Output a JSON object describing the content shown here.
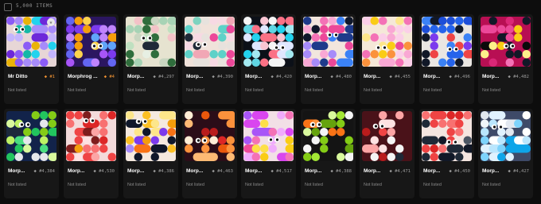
{
  "header": {
    "item_count": "5,000 ITEMS"
  },
  "cards": [
    {
      "name": "Mr Ditto",
      "number": "#1",
      "status": "Not listed",
      "special": true,
      "badge": true,
      "bg": "#e7d6d6",
      "colors": [
        "#8b5cf6",
        "#6d28d9",
        "#c4b5fd",
        "#a78bfa",
        "#eab308",
        "#22d3ee",
        "#14b8a6"
      ]
    },
    {
      "name": "Morphrog ...",
      "number": "#4",
      "status": "Not listed",
      "special": true,
      "badge": false,
      "bg": "#2b1660",
      "colors": [
        "#7c3aed",
        "#a855f7",
        "#fcd34d",
        "#f59e0b",
        "#c084fc",
        "#60a5fa",
        "#6366f1"
      ]
    },
    {
      "name": "Morp...",
      "number": "#4,297",
      "status": "Not listed",
      "special": false,
      "badge": false,
      "bg": "#e6e3d0",
      "colors": [
        "#2f6d3c",
        "#bfe0c0",
        "#e7efe3",
        "#c9d6c1",
        "#f3c2c7",
        "#1f2937",
        "#a7d3b5"
      ]
    },
    {
      "name": "Morp...",
      "number": "#4,390",
      "status": "Not listed",
      "special": false,
      "badge": false,
      "bg": "#f0e2da",
      "colors": [
        "#5ed1c8",
        "#f1a7b5",
        "#f7d9e3",
        "#1f2937",
        "#e7e2dd",
        "#ec4899",
        "#7dd3c0"
      ]
    },
    {
      "name": "Morp...",
      "number": "#4,420",
      "status": "Not listed",
      "special": false,
      "badge": false,
      "bg": "#0c1018",
      "colors": [
        "#60d6e3",
        "#f9c6d3",
        "#f5f5f5",
        "#fb7185",
        "#a3e9f0",
        "#e0e7ff",
        "#22d3ee"
      ]
    },
    {
      "name": "Morp...",
      "number": "#4,480",
      "status": "Not listed",
      "special": false,
      "badge": false,
      "bg": "#f2e6dd",
      "colors": [
        "#1e3a8a",
        "#ec4899",
        "#f9a8d4",
        "#3b82f6",
        "#a78bfa",
        "#f472b6",
        "#0f172a"
      ]
    },
    {
      "name": "Morp...",
      "number": "#4,455",
      "status": "Not listed",
      "special": false,
      "badge": false,
      "bg": "#f5e8d8",
      "colors": [
        "#f9a8d4",
        "#facc15",
        "#f472b6",
        "#ec4899",
        "#fde68a",
        "#fb923c",
        "#fbcfe8"
      ]
    },
    {
      "name": "Morp...",
      "number": "#4,496",
      "status": "Not listed",
      "special": false,
      "badge": false,
      "bg": "#eae6e2",
      "colors": [
        "#7c3aed",
        "#2563eb",
        "#1d4ed8",
        "#a78bfa",
        "#3b82f6",
        "#111827",
        "#ef4444"
      ]
    },
    {
      "name": "Morp...",
      "number": "#4,482",
      "status": "Not listed",
      "special": false,
      "badge": false,
      "bg": "#b80f53",
      "colors": [
        "#ec4899",
        "#facc15",
        "#0a0a0a",
        "#f472b6",
        "#fef08a",
        "#db2777",
        "#111827"
      ]
    },
    {
      "name": "Morp...",
      "number": "#4,384",
      "status": "Not listed",
      "special": false,
      "badge": false,
      "bg": "#12234a",
      "colors": [
        "#84cc16",
        "#22c55e",
        "#e5e7eb",
        "#bef264",
        "#1e293b",
        "#4ade80",
        "#d9f99d"
      ]
    },
    {
      "name": "Morp...",
      "number": "#4,530",
      "status": "Not listed",
      "special": false,
      "badge": false,
      "bg": "#f3dada",
      "colors": [
        "#ef4444",
        "#dc2626",
        "#f87171",
        "#fca5a5",
        "#7f1d1d",
        "#fee2e2",
        "#f59e0b"
      ]
    },
    {
      "name": "Morp...",
      "number": "#4,386",
      "status": "Not listed",
      "special": false,
      "badge": false,
      "bg": "#f5e9df",
      "colors": [
        "#f59e0b",
        "#7c3aed",
        "#fbbf24",
        "#0f172a",
        "#f97316",
        "#a78bfa",
        "#fde68a"
      ]
    },
    {
      "name": "Morp...",
      "number": "#4,463",
      "status": "Not listed",
      "special": false,
      "badge": false,
      "bg": "#2b0d18",
      "colors": [
        "#f97316",
        "#ea580c",
        "#dc2626",
        "#fdba74",
        "#ffedd5",
        "#b91c1c",
        "#fb923c"
      ]
    },
    {
      "name": "Morp...",
      "number": "#4,517",
      "status": "Not listed",
      "special": false,
      "badge": false,
      "bg": "#f2dfe6",
      "colors": [
        "#fde047",
        "#ec4899",
        "#d946ef",
        "#a855f7",
        "#f472b6",
        "#facc15",
        "#f0abfc"
      ]
    },
    {
      "name": "Morp...",
      "number": "#4,388",
      "status": "Not listed",
      "special": false,
      "badge": false,
      "bg": "#141414",
      "colors": [
        "#84cc16",
        "#65a30d",
        "#d9f99d",
        "#f97316",
        "#fb923c",
        "#a3e635",
        "#f5f5f5"
      ]
    },
    {
      "name": "Morp...",
      "number": "#4,471",
      "status": "Not listed",
      "special": false,
      "badge": false,
      "bg": "#4a1219",
      "colors": [
        "#f5f5f5",
        "#dc2626",
        "#ef4444",
        "#1f2937",
        "#fca5a5",
        "#b91c1c",
        "#fee2e2"
      ]
    },
    {
      "name": "Morp...",
      "number": "#4,450",
      "status": "Not listed",
      "special": false,
      "badge": false,
      "bg": "#f4e5e0",
      "colors": [
        "#dc2626",
        "#374151",
        "#1f2937",
        "#ef4444",
        "#4b5563",
        "#f87171",
        "#111827"
      ]
    },
    {
      "name": "Morp...",
      "number": "#4,427",
      "status": "Not listed",
      "special": false,
      "badge": false,
      "bg": "#3e4a68",
      "colors": [
        "#e0f2fe",
        "#f1f5f9",
        "#bae6fd",
        "#7dd3fc",
        "#e2e8f0",
        "#0ea5e9",
        "#ffffff"
      ]
    }
  ],
  "colors": {
    "background": "#0d0d0d",
    "card": "#171717",
    "special_number": "#f19332",
    "muted": "#8a8a8a"
  }
}
